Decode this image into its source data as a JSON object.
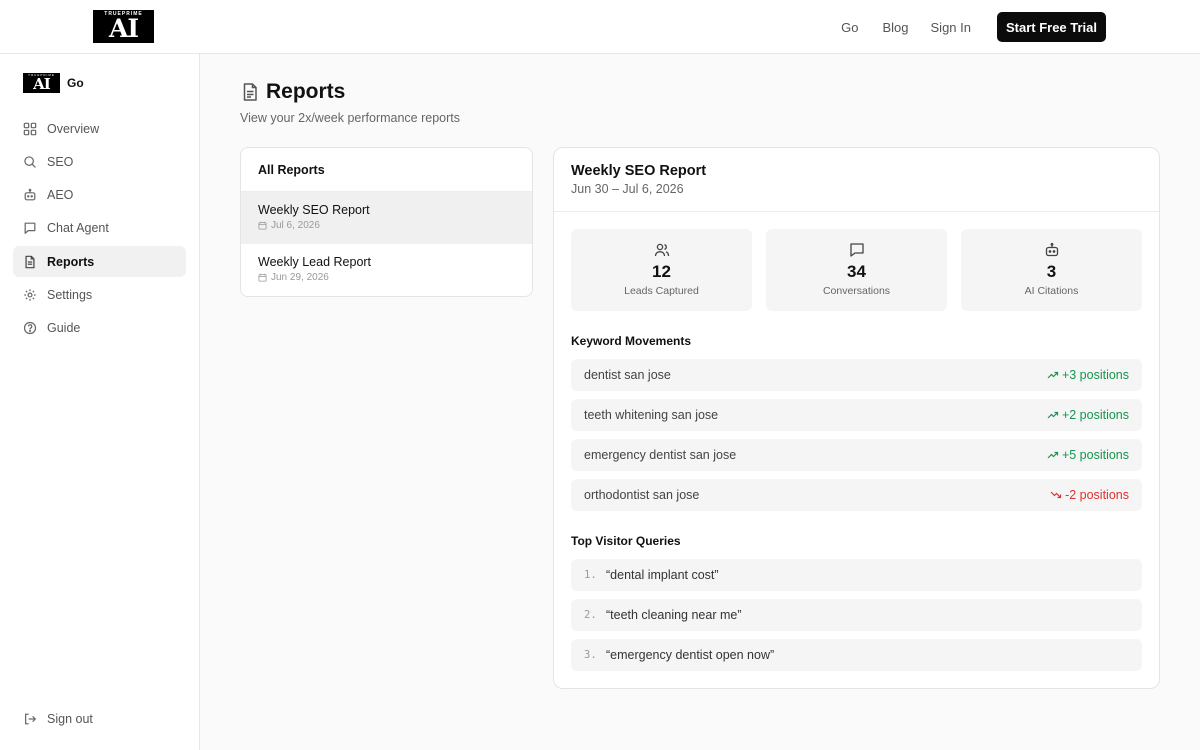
{
  "brand": {
    "logo_top": "TRUEPRIME",
    "logo_mark": "AI",
    "product": "Go"
  },
  "topnav": {
    "links": [
      "Go",
      "Blog",
      "Sign In"
    ],
    "cta": "Start Free Trial"
  },
  "sidebar": {
    "items": [
      {
        "label": "Overview",
        "icon": "grid-icon"
      },
      {
        "label": "SEO",
        "icon": "search-icon"
      },
      {
        "label": "AEO",
        "icon": "bot-icon"
      },
      {
        "label": "Chat Agent",
        "icon": "chat-icon"
      },
      {
        "label": "Reports",
        "icon": "document-icon",
        "active": true
      },
      {
        "label": "Settings",
        "icon": "gear-icon"
      },
      {
        "label": "Guide",
        "icon": "help-icon"
      }
    ],
    "signout": "Sign out"
  },
  "page": {
    "title": "Reports",
    "subtitle": "View your 2x/week performance reports"
  },
  "reports_list": {
    "header": "All Reports",
    "items": [
      {
        "name": "Weekly SEO Report",
        "date": "Jul 6, 2026",
        "active": true
      },
      {
        "name": "Weekly Lead Report",
        "date": "Jun 29, 2026",
        "active": false
      }
    ]
  },
  "detail": {
    "title": "Weekly SEO Report",
    "range": "Jun 30 – Jul 6, 2026",
    "stats": [
      {
        "value": "12",
        "label": "Leads Captured",
        "icon": "users-icon"
      },
      {
        "value": "34",
        "label": "Conversations",
        "icon": "chat-icon"
      },
      {
        "value": "3",
        "label": "AI Citations",
        "icon": "bot-icon"
      }
    ],
    "keywords_title": "Keyword Movements",
    "keywords": [
      {
        "term": "dentist san jose",
        "change": "+3 positions",
        "direction": "up"
      },
      {
        "term": "teeth whitening san jose",
        "change": "+2 positions",
        "direction": "up"
      },
      {
        "term": "emergency dentist san jose",
        "change": "+5 positions",
        "direction": "up"
      },
      {
        "term": "orthodontist san jose",
        "change": "-2 positions",
        "direction": "down"
      }
    ],
    "queries_title": "Top Visitor Queries",
    "queries": [
      {
        "idx": "1.",
        "text": "“dental implant cost”"
      },
      {
        "idx": "2.",
        "text": "“teeth cleaning near me”"
      },
      {
        "idx": "3.",
        "text": "“emergency dentist open now”"
      }
    ]
  },
  "colors": {
    "accent": "#0b0b0b",
    "up": "#15964f",
    "down": "#e03131",
    "panel": "#f5f5f5"
  }
}
